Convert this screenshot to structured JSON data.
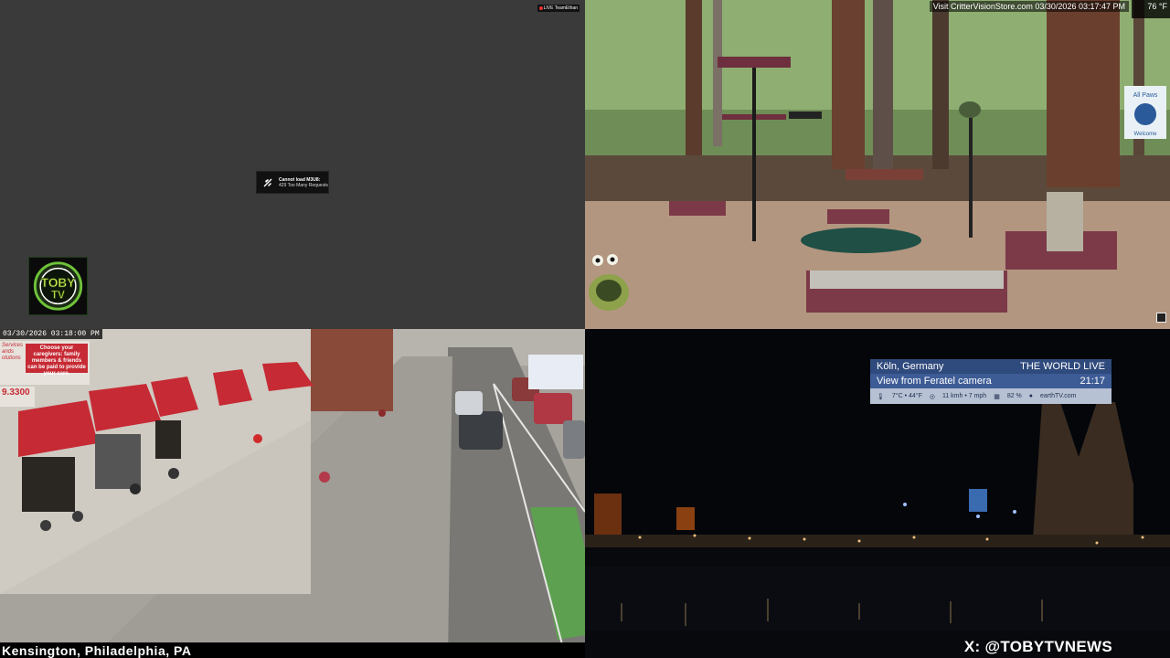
{
  "top_left": {
    "error_title": "Cannot load M3U8:",
    "error_detail": "429 Too Many Requests",
    "live_badge": "LIVE TeamEthan",
    "logo_text_top": "TOBY",
    "logo_text_bottom": "TV"
  },
  "top_right": {
    "overlay_text": "Visit CritterVisionStore.com 03/30/2026 03:17:47 PM",
    "temperature": "76 °F",
    "banner_line1": "All Paws",
    "banner_line2": "Welcome"
  },
  "bottom_left": {
    "timestamp": "03/30/2026 03:18:00 PM",
    "sign_lines": [
      "Services",
      "ands",
      "olutions"
    ],
    "sign_message": "Choose your caregivers: family members & friends can be paid to provide your care.",
    "sign_phone": "9.3300",
    "location_caption": "Kensington, Philadelphia, PA"
  },
  "bottom_right": {
    "city": "Köln, Germany",
    "brand": "THE WORLD LIVE",
    "view_label": "View from Feratel camera",
    "time": "21:17",
    "temp": "7°C • 44°F",
    "wind": "11 kmh • 7 mph",
    "humidity": "82 %",
    "site": "earthTV.com"
  },
  "footer": {
    "handle": "X: @TOBYTVNEWS"
  }
}
